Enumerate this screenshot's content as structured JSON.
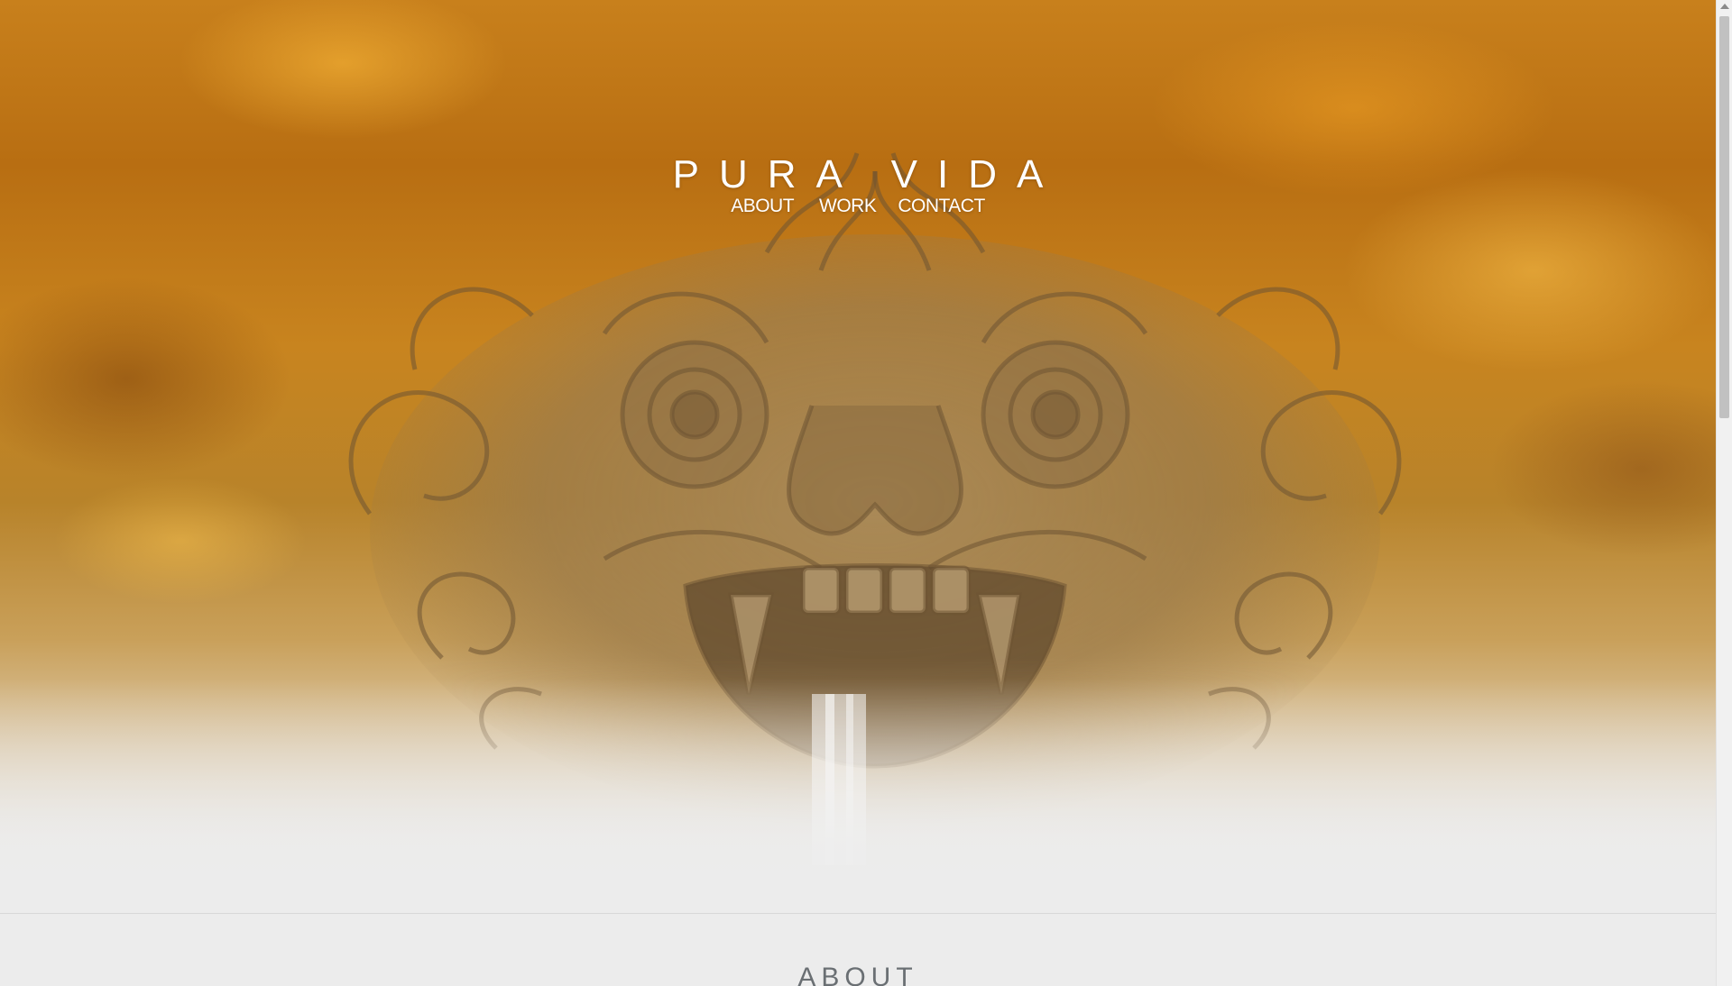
{
  "site": {
    "title": "PURA VIDA"
  },
  "nav": {
    "items": [
      {
        "label": "ABOUT"
      },
      {
        "label": "WORK"
      },
      {
        "label": "CONTACT"
      }
    ]
  },
  "hero": {
    "image": "carved-stone-mask-fountain-with-golden-clouds"
  },
  "about": {
    "heading": "ABOUT"
  },
  "colors": {
    "hero_gold": "#c8801c",
    "background": "#ececec",
    "title_text": "#ffffff",
    "heading_text": "#6a6f73"
  }
}
